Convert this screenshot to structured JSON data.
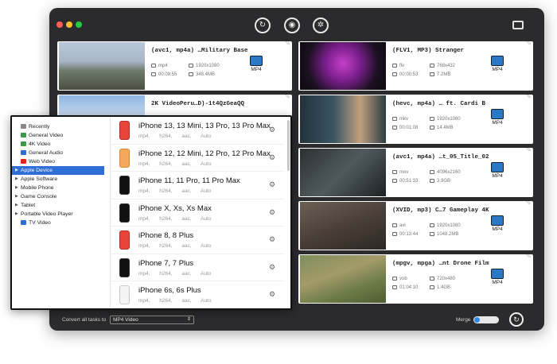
{
  "toolbar": {
    "convert_icon": "convert-icon",
    "dvd_icon": "dvd-icon",
    "film_icon": "film-reel-icon",
    "toolbox_icon": "toolbox-icon"
  },
  "left_files": [
    {
      "title": "(avc1, mp4a) …Military Base",
      "container": "mp4",
      "resolution": "1920x1080",
      "duration": "00:09:55",
      "size": "348.4MB",
      "target": "MP4"
    },
    {
      "title": "2K VideoPeru…D)-1t4QzGeaQQ",
      "container": "",
      "resolution": "",
      "duration": "",
      "size": "",
      "target": ""
    }
  ],
  "right_files": [
    {
      "title": "(FLV1, MP3) Stranger",
      "container": "flv",
      "resolution": "768x432",
      "duration": "00:00:53",
      "size": "7.2MB",
      "target": "MP4"
    },
    {
      "title": "(hevc, mp4a) … ft. Cardi B",
      "container": "mkv",
      "resolution": "1920x1080",
      "duration": "00:01:08",
      "size": "14.4MB",
      "target": "MP4"
    },
    {
      "title": "(avc1, mp4a) …t_05_Title_02",
      "container": "mov",
      "resolution": "4096x2160",
      "duration": "00:51:33",
      "size": "3.9GB",
      "target": "MP4"
    },
    {
      "title": "(XVID, mp3) C…7 Gameplay 4K",
      "container": "avi",
      "resolution": "1920x1080",
      "duration": "00:13:44",
      "size": "1048.2MB",
      "target": "MP4"
    },
    {
      "title": "(mpgv, mpga) …nt Drone Film",
      "container": "vob",
      "resolution": "720x480",
      "duration": "01:04:10",
      "size": "1.4GB",
      "target": "MP4"
    }
  ],
  "categories": [
    {
      "label": "Recently",
      "icon": "clock-icon",
      "color": "#888888"
    },
    {
      "label": "General Video",
      "icon": "video-icon",
      "color": "#3a9a4a"
    },
    {
      "label": "4K Video",
      "icon": "4k-icon",
      "color": "#3a9a4a"
    },
    {
      "label": "General Audio",
      "icon": "music-icon",
      "color": "#2e6ed6"
    },
    {
      "label": "Web Video",
      "icon": "youtube-icon",
      "color": "#e62117"
    },
    {
      "label": "Apple Device",
      "icon": "",
      "color": ""
    },
    {
      "label": "Apple Software",
      "icon": "",
      "color": ""
    },
    {
      "label": "Mobile Phone",
      "icon": "",
      "color": ""
    },
    {
      "label": "Game Console",
      "icon": "",
      "color": ""
    },
    {
      "label": "Tablet",
      "icon": "",
      "color": ""
    },
    {
      "label": "Portable Video Player",
      "icon": "",
      "color": ""
    },
    {
      "label": "TV Video",
      "icon": "tv-icon",
      "color": "#2e6ed6"
    }
  ],
  "selected_category": "Apple Device",
  "devices": [
    {
      "name": "iPhone 13, 13 Mini, 13 Pro, 13 Pro Max",
      "specs": [
        "mp4,",
        "h264,",
        "aac,",
        "Auto"
      ],
      "style": "red"
    },
    {
      "name": "iPhone 12, 12 Mini, 12 Pro, 12 Pro Max",
      "specs": [
        "mp4,",
        "h264,",
        "aac,",
        "Auto"
      ],
      "style": "orange"
    },
    {
      "name": "iPhone 11, 11 Pro, 11 Pro Max",
      "specs": [
        "mp4,",
        "h264,",
        "aac,",
        "Auto"
      ],
      "style": "black"
    },
    {
      "name": "iPhone X, Xs, Xs Max",
      "specs": [
        "mp4,",
        "h264,",
        "aac,",
        "Auto"
      ],
      "style": "black"
    },
    {
      "name": "iPhone 8, 8 Plus",
      "specs": [
        "mp4,",
        "h264,",
        "aac,",
        "Auto"
      ],
      "style": "red"
    },
    {
      "name": "iPhone 7, 7 Plus",
      "specs": [
        "mp4,",
        "h264,",
        "aac,",
        "Auto"
      ],
      "style": "black"
    },
    {
      "name": "iPhone 6s, 6s Plus",
      "specs": [
        "mp4,",
        "h264,",
        "aac,",
        "Auto"
      ],
      "style": "white"
    }
  ],
  "bottom": {
    "convert_label": "Convert all tasks to",
    "convert_value": "MP4 Video",
    "merge_label": "Merge"
  }
}
